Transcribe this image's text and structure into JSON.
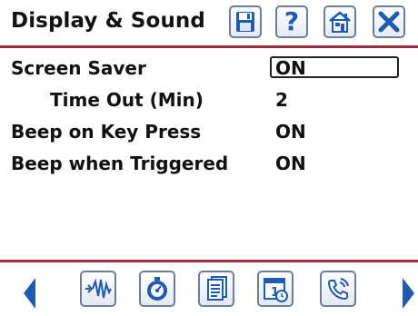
{
  "header": {
    "title": "Display & Sound",
    "buttons": [
      {
        "name": "save",
        "icon": "save-disk-icon"
      },
      {
        "name": "help",
        "icon": "question-icon",
        "glyph": "?"
      },
      {
        "name": "home",
        "icon": "home-icon"
      },
      {
        "name": "close",
        "icon": "close-icon"
      }
    ]
  },
  "settings": {
    "screen_saver": {
      "label": "Screen Saver",
      "value": "ON"
    },
    "time_out": {
      "label": "Time Out (Min)",
      "value": "2"
    },
    "beep_key": {
      "label": "Beep on Key Press",
      "value": "ON"
    },
    "beep_trigger": {
      "label": "Beep when Triggered",
      "value": "ON"
    }
  },
  "footer": {
    "nav_prev_icon": "left-arrow-icon",
    "nav_next_icon": "right-arrow-icon",
    "buttons": [
      {
        "name": "waveform",
        "icon": "waveform-icon"
      },
      {
        "name": "meter",
        "icon": "meter-dial-icon"
      },
      {
        "name": "pages",
        "icon": "pages-icon"
      },
      {
        "name": "calendar",
        "icon": "calendar-clock-icon",
        "day": "1"
      },
      {
        "name": "phone",
        "icon": "phone-icon"
      }
    ]
  },
  "colors": {
    "accent_rule": "#9b2e3a",
    "icon_blue": "#1f5bb3",
    "button_border": "#6c7f99"
  }
}
